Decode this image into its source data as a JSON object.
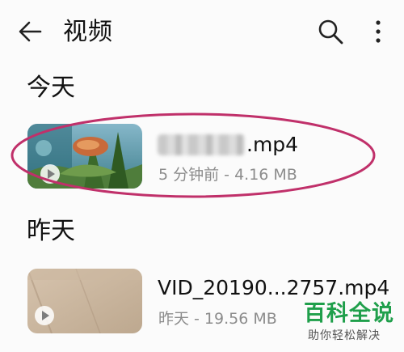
{
  "header": {
    "back_icon": "arrow-left-icon",
    "title": "视频",
    "search_icon": "search-icon",
    "more_icon": "more-vertical-icon"
  },
  "sections": [
    {
      "label": "今天",
      "files": [
        {
          "name": ".mp4",
          "meta": "5 分钟前 - 4.16 MB",
          "name_partially_blurred": true
        }
      ]
    },
    {
      "label": "昨天",
      "files": [
        {
          "name": "VID_20190...2757.mp4",
          "meta": "昨天 - 19.56 MB"
        }
      ]
    }
  ],
  "annotation": {
    "shape": "ellipse",
    "color": "#c0306a"
  },
  "watermark": {
    "main": "百科全说",
    "sub": "助你轻松解决"
  }
}
